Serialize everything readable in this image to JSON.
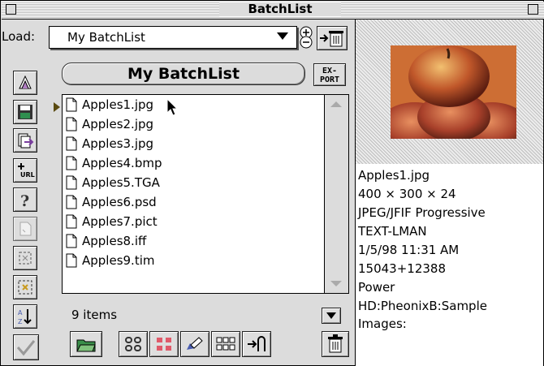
{
  "window": {
    "title": "BatchList"
  },
  "load": {
    "label": "Load:",
    "selected": "My BatchList"
  },
  "batchlist_name": "My BatchList",
  "export_button": {
    "line1": "EX-",
    "line2": "PORT"
  },
  "files": [
    "Apples1.jpg",
    "Apples2.jpg",
    "Apples3.jpg",
    "Apples4.bmp",
    "Apples5.TGA",
    "Apples6.psd",
    "Apples7.pict",
    "Apples8.iff",
    "Apples9.tim"
  ],
  "item_count": "9 items",
  "info": {
    "filename": "Apples1.jpg",
    "dimensions": "400 × 300 × 24",
    "format": "JPEG/JFIF Progressive",
    "type": "TEXT-LMAN",
    "date": "1/5/98 11:31 AM",
    "size": "15043+12388",
    "owner": "Power",
    "path": "HD:PheonixB:Sample",
    "folder": "Images:"
  },
  "toolbar_icons": [
    "open-icon",
    "save-icon",
    "add-file-icon",
    "add-url-icon",
    "help-icon",
    "page-icon",
    "select-frame-icon",
    "delete-frame-icon",
    "sort-az-icon",
    "checkmark-icon"
  ],
  "bottom_icons": [
    "folder-open-icon",
    "link-icon",
    "grid-red-icon",
    "edit-icon",
    "thumbnails-icon",
    "import-icon",
    "trash-icon"
  ],
  "colors": {
    "callout": "#d63a1e",
    "window_bg": "#dcdcdc"
  }
}
